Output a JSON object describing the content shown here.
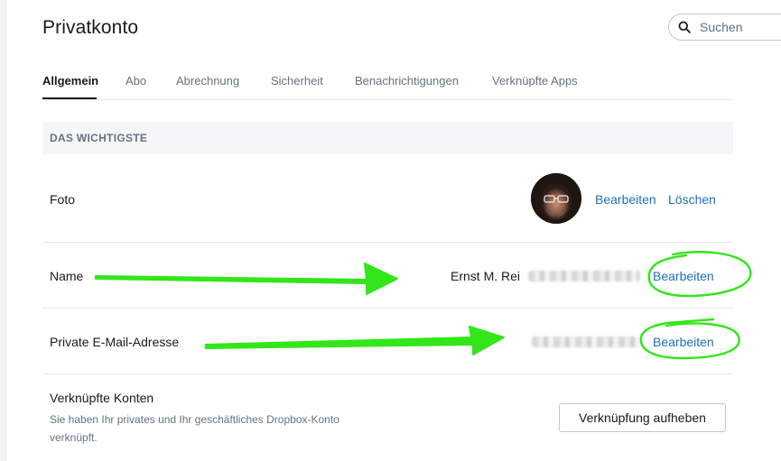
{
  "page": {
    "title": "Privatkonto"
  },
  "search": {
    "placeholder": "Suchen"
  },
  "tabs": [
    {
      "label": "Allgemein",
      "active": true
    },
    {
      "label": "Abo"
    },
    {
      "label": "Abrechnung"
    },
    {
      "label": "Sicherheit"
    },
    {
      "label": "Benachrichtigungen"
    },
    {
      "label": "Verknüpfte Apps"
    }
  ],
  "section": {
    "title": "DAS WICHTIGSTE"
  },
  "photo": {
    "label": "Foto",
    "edit": "Bearbeiten",
    "delete": "Löschen"
  },
  "name": {
    "label": "Name",
    "value_visible": "Ernst M. Rei",
    "edit": "Bearbeiten"
  },
  "email": {
    "label": "Private E-Mail-Adresse",
    "edit": "Bearbeiten"
  },
  "linked_accounts": {
    "label": "Verknüpfte Konten",
    "description": "Sie haben Ihr privates und Ihr geschäftliches Dropbox-Konto verknüpft.",
    "button": "Verknüpfung aufheben"
  },
  "colors": {
    "link": "#1f6fb8",
    "annotation": "#33e61a",
    "text": "#1e1919",
    "muted": "#637282"
  },
  "icons": {
    "search": "search-icon"
  }
}
